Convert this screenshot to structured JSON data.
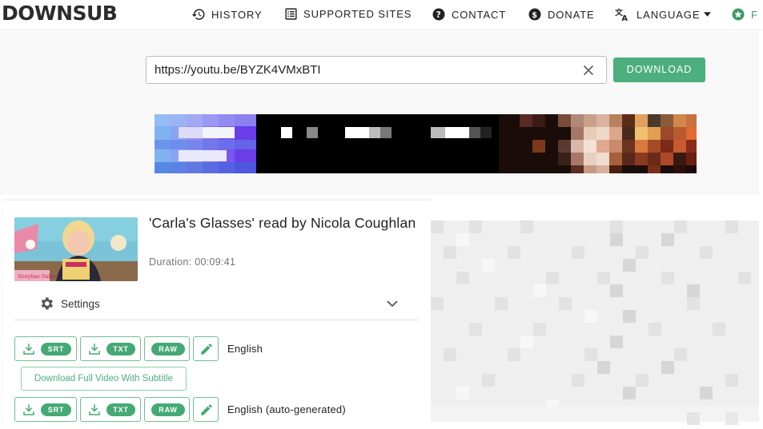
{
  "header": {
    "logo": "DOWNSUB",
    "nav": [
      {
        "label": "HISTORY",
        "icon": "history-icon"
      },
      {
        "label": "SUPPORTED SITES",
        "icon": "list-icon"
      },
      {
        "label": "CONTACT",
        "icon": "help-icon"
      },
      {
        "label": "DONATE",
        "icon": "dollar-icon"
      },
      {
        "label": "LANGUAGE",
        "icon": "translate-icon"
      },
      {
        "label": "F",
        "icon": "star-icon"
      }
    ]
  },
  "search": {
    "value": "https://youtu.be/BYZK4VMxBTI",
    "button": "DOWNLOAD"
  },
  "video": {
    "title": "'Carla's Glasses' read by Nicola Coughlan",
    "duration": "Duration: 00:09:41",
    "settings_label": "Settings"
  },
  "subtitles": [
    {
      "language": "English",
      "formats": [
        "SRT",
        "TXT",
        "RAW"
      ]
    },
    {
      "language": "English (auto-generated)",
      "formats": [
        "SRT",
        "TXT",
        "RAW"
      ]
    }
  ],
  "full_video_button": "Download Full Video With Subtitle",
  "colors": {
    "accent": "#4caf7d",
    "pill": "#46a975"
  }
}
